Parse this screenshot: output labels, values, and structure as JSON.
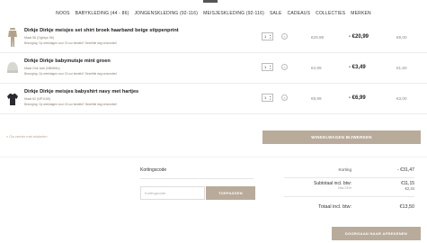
{
  "nav": {
    "items": [
      "NOOS",
      "BABYKLEDING (44 - 86)",
      "JONGENSKLEDING (92-116)",
      "MEISJESKLEDING (92-116)",
      "SALE",
      "CADEAUS",
      "COLLECTIES",
      "MERKEN"
    ]
  },
  "cart": {
    "items": [
      {
        "title": "Dirkje Dirkje meisjes set shirt broek haarband beige stippenprint",
        "size": "Maat 56 (Ogl/spr 56)",
        "note": "Bezorging: Op werkdagen voor 15 uur besteld? Dezelfde dag verzonden!",
        "quantity": "1",
        "old_price": "€29,99",
        "new_price": "- €20,99",
        "total": "€9,00",
        "thumb_color": "#b5a48a",
        "icon": "outfit-thumbnail"
      },
      {
        "title": "Dirkje Dirkje babymutsje mint groen",
        "size": "Maat One size (NB/6Mo)",
        "note": "Bezorging: Op werkdagen voor 15 uur besteld? Dezelfde dag verzonden!",
        "quantity": "1",
        "old_price": "€4,99",
        "new_price": "- €3,49",
        "total": "€1,50",
        "thumb_color": "#d8d8d2",
        "icon": "hat-thumbnail"
      },
      {
        "title": "Dirkje Dirkje meisjes babyshirt navy met hartjes",
        "size": "Maat 62 (NP1159)",
        "note": "Bezorging: Op werkdagen voor 15 uur besteld? Dezelfde dag verzonden!",
        "quantity": "1",
        "old_price": "€9,99",
        "new_price": "- €6,99",
        "total": "€3,00",
        "thumb_color": "#2a2a30",
        "icon": "shirt-thumbnail"
      }
    ],
    "continue_link": "« Ga verder met winkelen",
    "refresh_label": "WINKELWAGEN BIJWERKEN"
  },
  "coupon": {
    "label": "Kortingscode",
    "placeholder": "Kortingscode",
    "button": "TOEPASSEN"
  },
  "summary": {
    "discount_label": "Korting",
    "discount_value": "- €31,47",
    "subtotal_label": "Subtotaal incl. btw:",
    "subtotal_value": "€11,15",
    "vat_label": "btw 21%",
    "vat_value": "€2,34",
    "total_label": "Totaal incl. btw:",
    "total_value": "€13,50",
    "checkout_label": "DOORGAAN NAAR AFREKENEN"
  },
  "colors": {
    "accent": "#b9ab9a",
    "link": "#b9a58d"
  }
}
